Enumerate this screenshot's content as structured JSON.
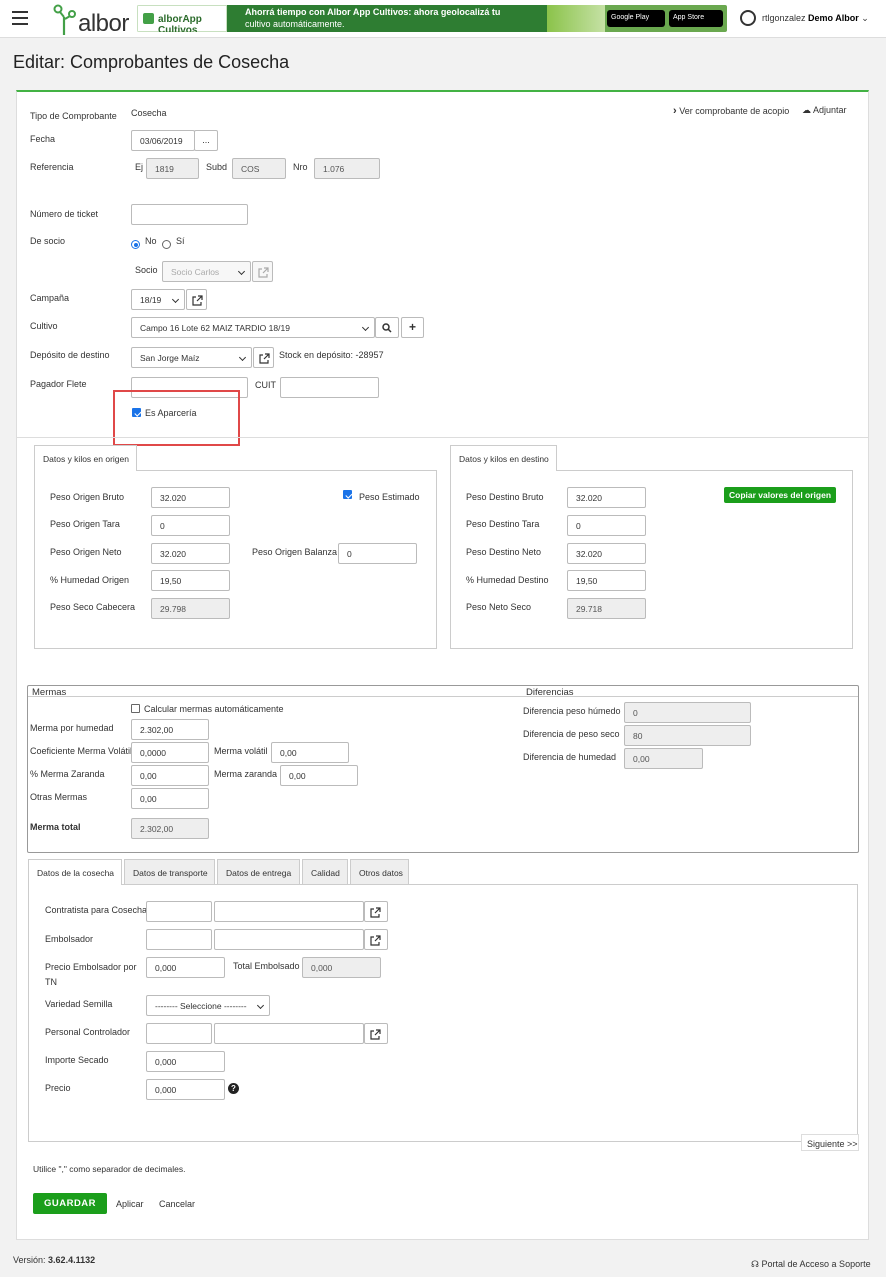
{
  "header": {
    "logo_text": "albor",
    "banner_app": "alborApp Cultivos",
    "banner_line1": "Ahorrá tiempo con Albor App Cultivos: ahora geolocalizá tu",
    "banner_line2": "cultivo automáticamente.",
    "google_play": "Google Play",
    "app_store": "App Store",
    "user": "rtlgonzalez",
    "company": "Demo Albor"
  },
  "page_title": "Editar: Comprobantes de Cosecha",
  "form": {
    "tipo_label": "Tipo de Comprobante",
    "tipo_value": "Cosecha",
    "ver_comprobante": "Ver comprobante de acopio",
    "adjuntar": "Adjuntar",
    "fecha_label": "Fecha",
    "fecha_value": "03/06/2019",
    "fecha_btn": "...",
    "referencia_label": "Referencia",
    "ej_label": "Ej",
    "ej_value": "1819",
    "subd_label": "Subd",
    "subd_value": "COS",
    "nro_label": "Nro",
    "nro_value": "1.076",
    "ticket_label": "Número de ticket",
    "ticket_value": "",
    "socio_label": "De socio",
    "no_label": "No",
    "si_label": "Sí",
    "socio_sub_label": "Socio",
    "socio_value": "Socio Carlos",
    "campana_label": "Campaña",
    "campana_value": "18/19",
    "cultivo_label": "Cultivo",
    "cultivo_value": "Campo 16 Lote 62 MAIZ TARDIO 18/19",
    "deposito_label": "Depósito de destino",
    "deposito_value": "San Jorge Maíz",
    "stock_text": "Stock en depósito: -28957",
    "pagador_label": "Pagador Flete",
    "cuit_label": "CUIT",
    "aparceria_label": "Es Aparcería"
  },
  "origen": {
    "tab": "Datos y kilos en origen",
    "bruto_label": "Peso Origen Bruto",
    "bruto": "32.020",
    "estimado_label": "Peso Estimado",
    "tara_label": "Peso Origen Tara",
    "tara": "0",
    "neto_label": "Peso Origen Neto",
    "neto": "32.020",
    "balanza_label": "Peso Origen Balanza",
    "balanza": "0",
    "humedad_label": "% Humedad Origen",
    "humedad": "19,50",
    "seco_label": "Peso Seco Cabecera",
    "seco": "29.798"
  },
  "destino": {
    "tab": "Datos y kilos en destino",
    "copiar": "Copiar valores del origen",
    "bruto_label": "Peso Destino Bruto",
    "bruto": "32.020",
    "tara_label": "Peso Destino Tara",
    "tara": "0",
    "neto_label": "Peso Destino Neto",
    "neto": "32.020",
    "humedad_label": "% Humedad Destino",
    "humedad": "19,50",
    "seco_label": "Peso Neto Seco",
    "seco": "29.718"
  },
  "mermas": {
    "title": "Mermas",
    "calc_label": "Calcular mermas automáticamente",
    "humedad_label": "Merma por humedad",
    "humedad": "2.302,00",
    "coef_label": "Coeficiente Merma Volátil",
    "coef": "0,0000",
    "volatil_label": "Merma volátil",
    "volatil": "0,00",
    "zaranda_pct_label": "% Merma Zaranda",
    "zaranda_pct": "0,00",
    "zaranda_label": "Merma zaranda",
    "zaranda": "0,00",
    "otras_label": "Otras Mermas",
    "otras": "0,00",
    "total_label": "Merma total",
    "total": "2.302,00"
  },
  "diferencias": {
    "title": "Diferencias",
    "humedo_label": "Diferencia peso húmedo",
    "humedo": "0",
    "seco_label": "Diferencia de peso seco",
    "seco": "80",
    "humedad_label": "Diferencia de humedad",
    "humedad": "0,00"
  },
  "tabs": [
    "Datos de la cosecha",
    "Datos de transporte",
    "Datos de entrega",
    "Calidad",
    "Otros datos"
  ],
  "cosecha": {
    "contratista_label": "Contratista para Cosecha",
    "embolsador_label": "Embolsador",
    "precio_emb_label1": "Precio Embolsador por",
    "precio_emb_label2": "TN",
    "precio_emb": "0,000",
    "total_emb_label": "Total Embolsado",
    "total_emb": "0,000",
    "variedad_label": "Variedad Semilla",
    "variedad_value": "-------- Seleccione --------",
    "personal_label": "Personal Controlador",
    "secado_label": "Importe Secado",
    "secado": "0,000",
    "precio_label": "Precio",
    "precio": "0,000"
  },
  "siguiente": "Siguiente >>",
  "nota": "Utilice \",\" como separador de decimales.",
  "guardar": "GUARDAR",
  "aplicar": "Aplicar",
  "cancelar": "Cancelar",
  "footer": {
    "version_label": "Versión:",
    "version": "3.62.4.1132",
    "soporte": "Portal de Acceso a Soporte"
  }
}
